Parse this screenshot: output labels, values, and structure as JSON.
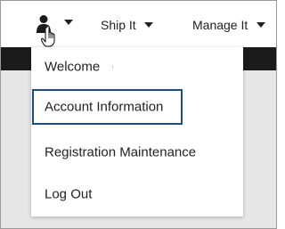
{
  "nav": {
    "ship_it_label": "Ship It",
    "manage_it_label": "Manage It",
    "user_icon": "user-icon",
    "cursor_icon": "hand-pointer-icon"
  },
  "menu": {
    "items": [
      {
        "label": "Welcome"
      },
      {
        "label": "Account Information"
      },
      {
        "label": "Registration Maintenance"
      },
      {
        "label": "Log Out"
      }
    ],
    "focus_color": "#1f4e79"
  },
  "colors": {
    "dark_band": "#1b1b1b",
    "page_background": "#e6e6e6"
  }
}
